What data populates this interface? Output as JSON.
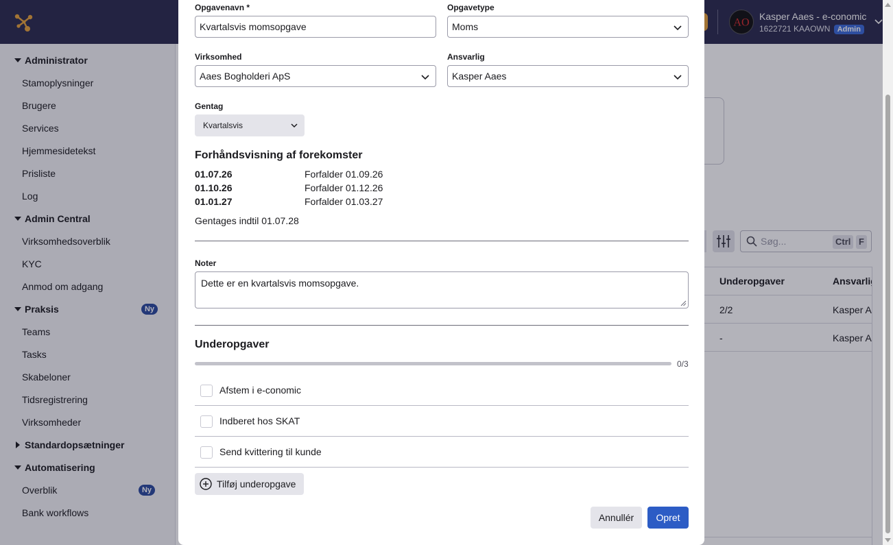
{
  "header": {
    "user_name": "Kasper Aaes - e-conomic",
    "user_id": "1622721 KAAOWN",
    "admin_badge": "Admin",
    "avatar_initials": "AO"
  },
  "sidebar": {
    "sections": [
      {
        "label": "Administrator",
        "items": [
          "Stamoplysninger",
          "Brugere",
          "Services",
          "Hjemmesidetekst",
          "Prisliste",
          "Log"
        ]
      },
      {
        "label": "Admin Central",
        "items": [
          "Virksomhedsoverblik",
          "KYC",
          "Anmod om adgang"
        ]
      },
      {
        "label": "Praksis",
        "badge": "Ny",
        "items": [
          "Teams",
          "Tasks",
          "Skabeloner",
          "Tidsregistrering",
          "Virksomheder"
        ]
      },
      {
        "label": "Standardopsætninger",
        "collapsed": true
      },
      {
        "label": "Automatisering",
        "items": [
          "Overblik",
          "Bank workflows"
        ],
        "item_badge": "Ny"
      }
    ]
  },
  "background": {
    "search_placeholder": "Søg...",
    "kbd_ctrl": "Ctrl",
    "kbd_f": "F",
    "table_headers": [
      "Underopgaver",
      "Ansvarlig"
    ],
    "rows": [
      {
        "subtasks": "2/2",
        "responsible": "Kasper Aaes"
      },
      {
        "subtasks": "-",
        "responsible": "Kasper Aaes"
      }
    ]
  },
  "form": {
    "task_name_label": "Opgavenavn *",
    "task_name_value": "Kvartalsvis momsopgave",
    "task_type_label": "Opgavetype",
    "task_type_value": "Moms",
    "company_label": "Virksomhed",
    "company_value": "Aaes Bogholderi ApS",
    "responsible_label": "Ansvarlig",
    "responsible_value": "Kasper Aaes",
    "repeat_label": "Gentag",
    "repeat_value": "Kvartalsvis",
    "preview_heading": "Forhåndsvisning af forekomster",
    "occurrences": [
      {
        "date": "01.07.26",
        "due": "Forfalder 01.09.26"
      },
      {
        "date": "01.10.26",
        "due": "Forfalder 01.12.26"
      },
      {
        "date": "01.01.27",
        "due": "Forfalder 01.03.27"
      }
    ],
    "repeats_until": "Gentages indtil 01.07.28",
    "notes_label": "Noter",
    "notes_value": "Dette er en kvartalsvis momsopgave.",
    "subtasks_heading": "Underopgaver",
    "subtasks_progress": 0,
    "subtasks_count": "0/3",
    "subtasks": [
      "Afstem i e-conomic",
      "Indberet hos SKAT",
      "Send kvittering til kunde"
    ],
    "add_subtask_label": "Tilføj underopgave",
    "cancel_label": "Annullér",
    "create_label": "Opret"
  },
  "colors": {
    "topbar": "#2c2c4e",
    "primary": "#2c5cc5",
    "badge": "#2c4a9e",
    "logo": "#e6a23c"
  }
}
